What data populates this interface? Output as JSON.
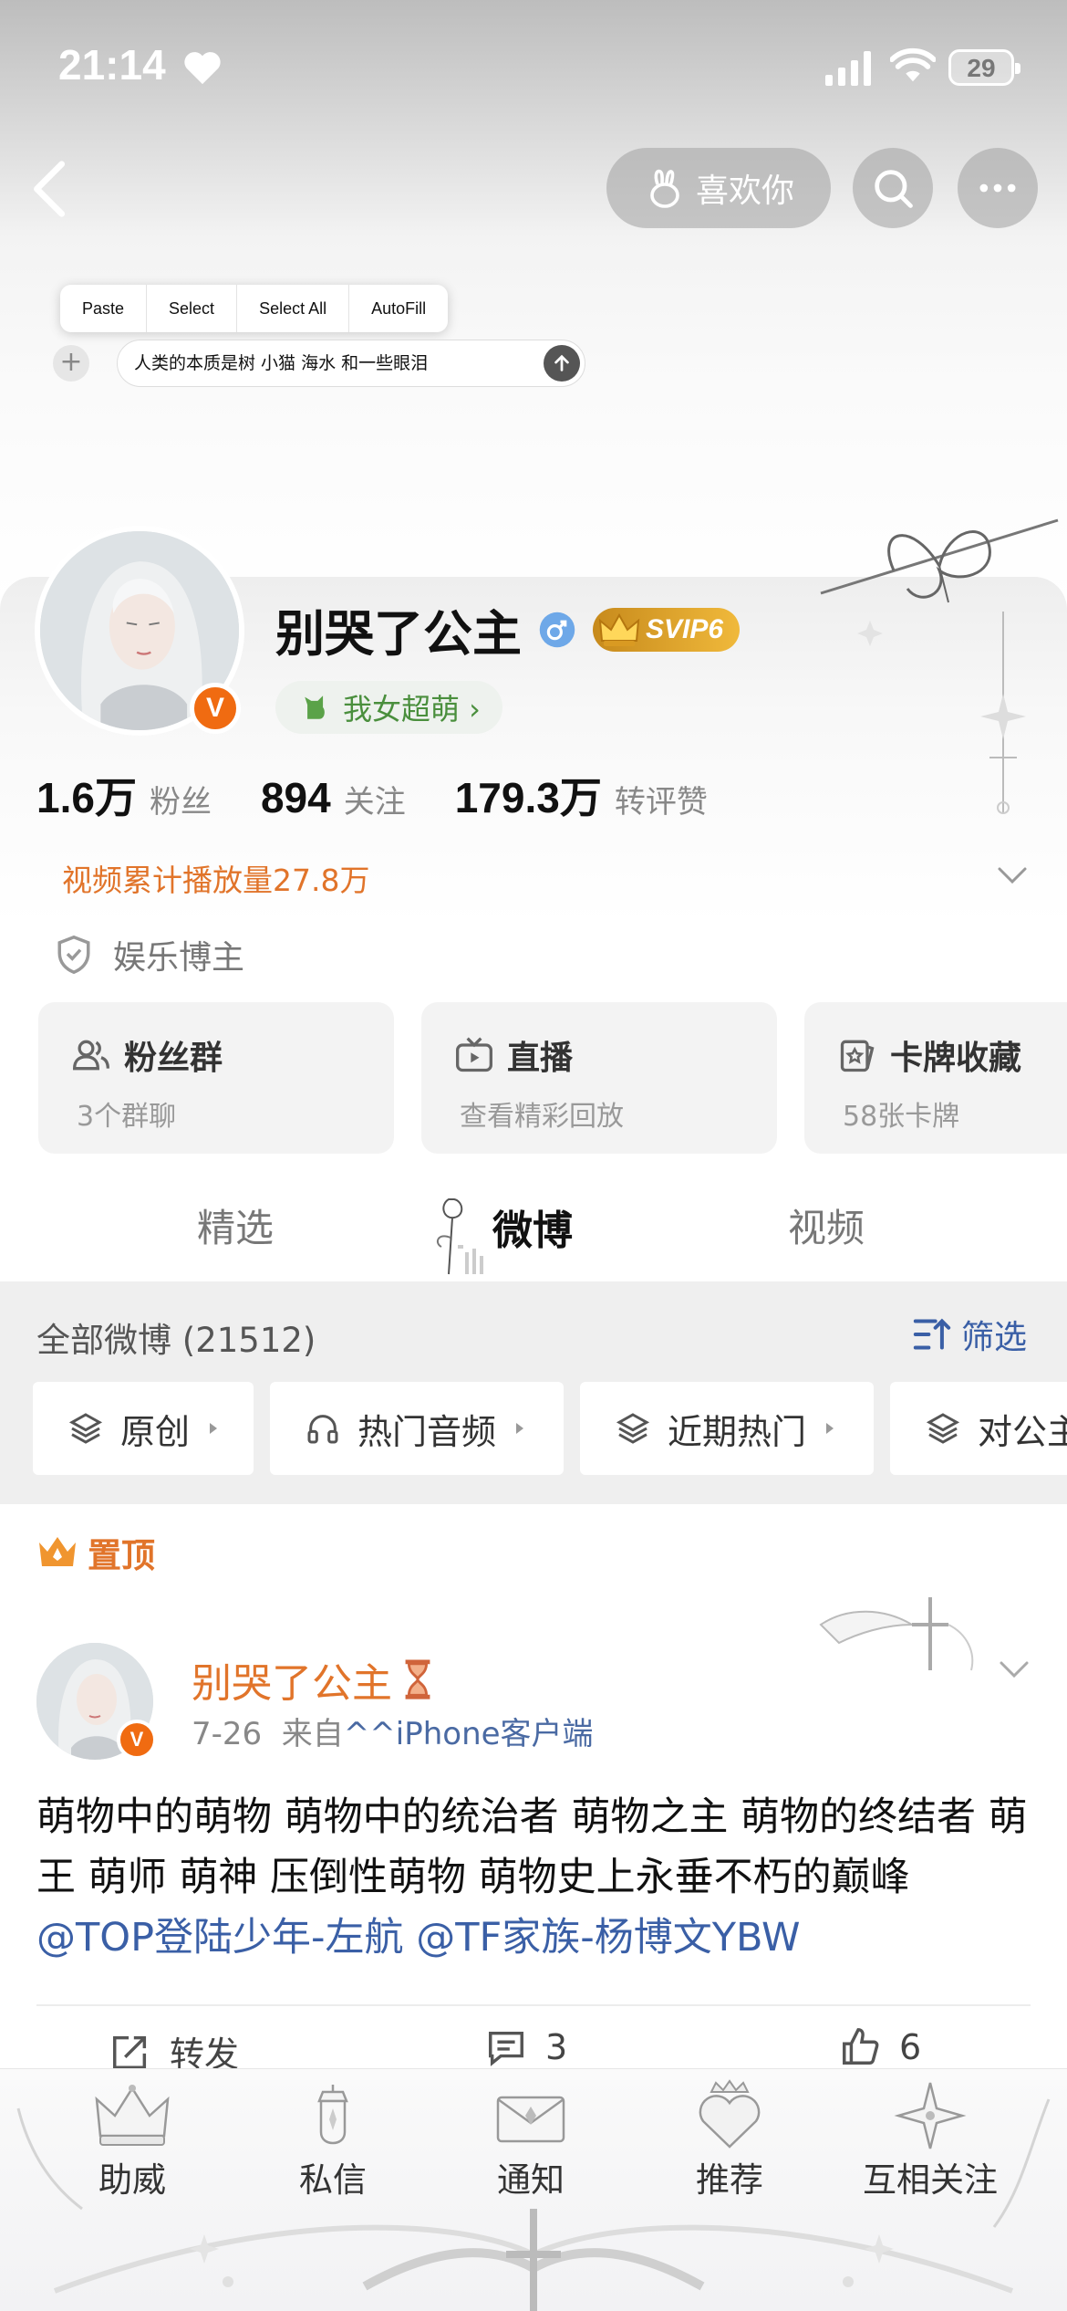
{
  "status_bar": {
    "time": "21:14",
    "battery": "29"
  },
  "nav": {
    "like_label": "喜欢你"
  },
  "paste_menu": {
    "items": [
      "Paste",
      "Select",
      "Select All",
      "AutoFill"
    ]
  },
  "compose": {
    "text": "人类的本质是树 小猫 海水 和一些眼泪"
  },
  "profile": {
    "username": "别哭了公主",
    "vip_label": "SVIP6",
    "verified_badge": "V",
    "tag": "我女超萌 ›",
    "stats": [
      {
        "num": "1.6万",
        "label": "粉丝"
      },
      {
        "num": "894",
        "label": "关注"
      },
      {
        "num": "179.3万",
        "label": "转评赞"
      }
    ],
    "video_plays": "视频累计播放量27.8万",
    "verify": "娱乐博主"
  },
  "feature_cards": [
    {
      "title": "粉丝群",
      "sub": "3个群聊",
      "icon": "users-icon"
    },
    {
      "title": "直播",
      "sub": "查看精彩回放",
      "icon": "tv-icon"
    },
    {
      "title": "卡牌收藏",
      "sub": "58张卡牌",
      "icon": "card-icon"
    }
  ],
  "tabs": [
    "精选",
    "微博",
    "视频"
  ],
  "feed": {
    "count_label": "全部微博 (21512)",
    "filter_label": "筛选",
    "chips": [
      "原创",
      "热门音频",
      "近期热门",
      "对公主"
    ],
    "pinned_label": "置顶",
    "post": {
      "author": "别哭了公主",
      "date": "7-26",
      "source_prefix": "来自",
      "source": "^^iPhone客户端",
      "text": "萌物中的萌物 萌物中的统治者 萌物之主 萌物的终结者 萌王 萌师 萌神 压倒性萌物 萌物史上永垂不朽的巅峰",
      "mention1": "@TOP登陆少年-左航",
      "mention2": "@TF家族-杨博文YBW",
      "actions": {
        "repost": "转发",
        "comments": "3",
        "likes": "6"
      }
    }
  },
  "bottom_bar": [
    "助威",
    "私信",
    "通知",
    "推荐",
    "互相关注"
  ],
  "colors": {
    "accent_orange": "#e1742a",
    "link_blue": "#3a5fa6",
    "vip_gold": "#e0a52e"
  }
}
